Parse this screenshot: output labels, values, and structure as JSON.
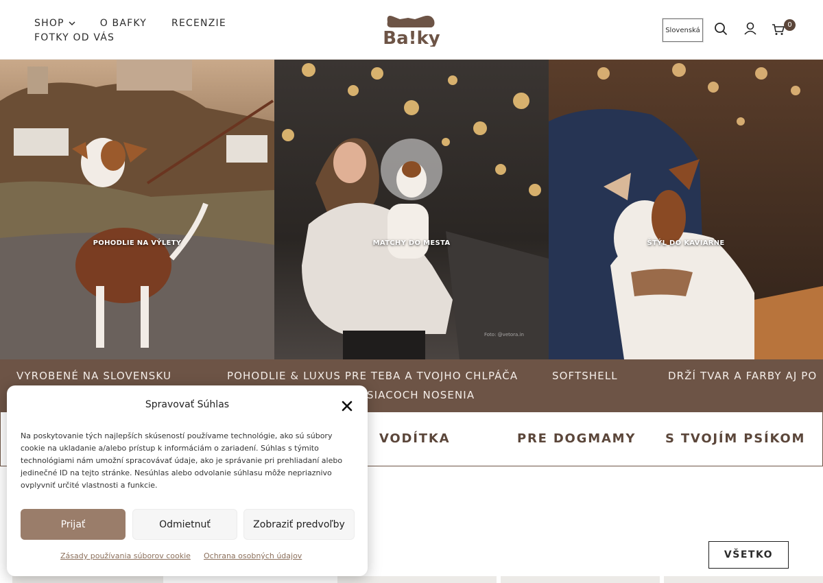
{
  "header": {
    "nav": {
      "shop": "SHOP",
      "about": "O BAFKY",
      "reviews": "RECENZIE",
      "photos": "FOTKY OD VÁS"
    },
    "logo_text": "Ba!ky",
    "language": "Slovenská",
    "cart_count": "0"
  },
  "hero": {
    "panels": [
      {
        "caption": "POHODLIE NA VÝLETY"
      },
      {
        "caption": "MATCHY DO MESTA",
        "credit": "Foto: @vetora.in"
      },
      {
        "caption": "ŠTÝL DO KAVIARNE"
      }
    ]
  },
  "strip": {
    "items": [
      "VYROBENÉ NA SLOVENSKU",
      "POHODLIE & LUXUS PRE TEBA A TVOJHO CHLPÁČA",
      "SOFTSHELL",
      "DRŽÍ TVAR A FARBY AJ PO",
      "SIACOCH NOSENIA"
    ]
  },
  "categories": [
    "VODÍTKA",
    "PRE DOGMAMY",
    "S TVOJÍM PSÍKOM"
  ],
  "all_button": "VŠETKO",
  "cookie_modal": {
    "title": "Spravovať Súhlas",
    "text": "Na poskytovanie tých najlepších skúseností používame technológie, ako sú súbory cookie na ukladanie a/alebo prístup k informáciám o zariadení. Súhlas s týmito technológiami nám umožní spracovávať údaje, ako je správanie pri prehliadaní alebo jedinečné ID na tejto stránke. Nesúhlas alebo odvolanie súhlasu môže nepriaznivo ovplyvniť určité vlastnosti a funkcie.",
    "accept": "Prijať",
    "deny": "Odmietnuť",
    "preferences": "Zobraziť predvoľby",
    "cookie_policy": "Zásady používania súborov cookie",
    "privacy": "Ochrana osobných údajov"
  },
  "icons": [
    "chevron-down-icon",
    "search-icon",
    "user-icon",
    "cart-icon",
    "close-icon"
  ],
  "colors": {
    "brand_brown": "#6d5446",
    "accept_button": "#9a7d6a",
    "badge": "#5b463a"
  }
}
